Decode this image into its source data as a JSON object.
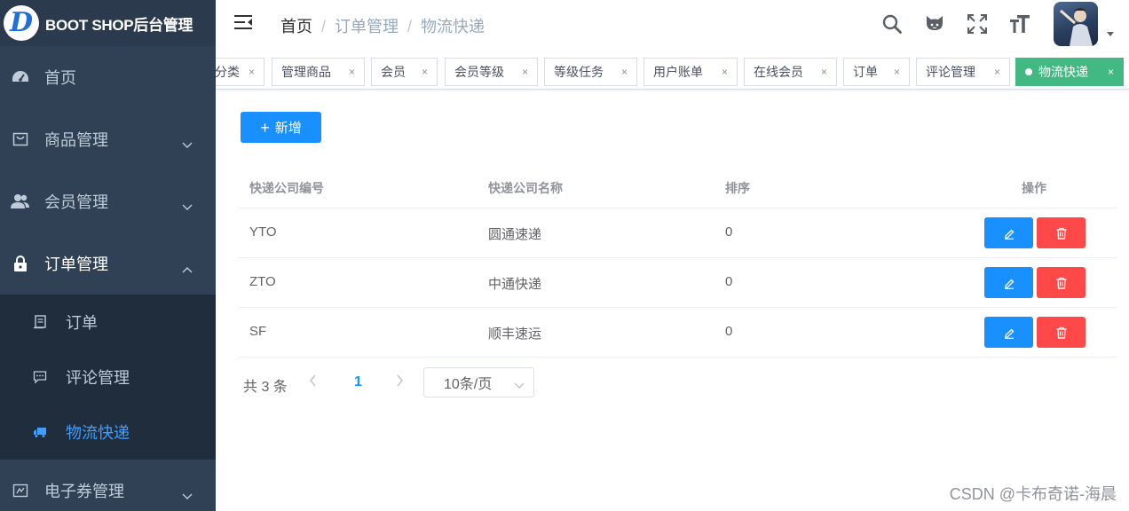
{
  "app": {
    "title": "BOOT SHOP后台管理",
    "logo_letter": "D"
  },
  "sidebar": {
    "items": [
      {
        "label": "首页",
        "icon": "dashboard-icon"
      },
      {
        "label": "商品管理",
        "icon": "shopping-bag-icon"
      },
      {
        "label": "会员管理",
        "icon": "users-icon"
      },
      {
        "label": "订单管理",
        "icon": "lock-icon"
      },
      {
        "label": "电子券管理",
        "icon": "coupon-icon"
      }
    ],
    "order_sub": [
      {
        "label": "订单",
        "icon": "document-icon"
      },
      {
        "label": "评论管理",
        "icon": "comment-icon"
      },
      {
        "label": "物流快递",
        "icon": "truck-icon"
      }
    ]
  },
  "breadcrumb": {
    "home": "首页",
    "section": "订单管理",
    "current": "物流快递",
    "separator": "/"
  },
  "tags": [
    {
      "label": "分类"
    },
    {
      "label": "管理商品"
    },
    {
      "label": "会员"
    },
    {
      "label": "会员等级"
    },
    {
      "label": "等级任务"
    },
    {
      "label": "用户账单"
    },
    {
      "label": "在线会员"
    },
    {
      "label": "订单"
    },
    {
      "label": "评论管理"
    },
    {
      "label": "物流快递",
      "active": true
    }
  ],
  "tag_close": "×",
  "toolbar": {
    "add_label": "新增",
    "add_icon": "+"
  },
  "table": {
    "headers": {
      "code": "快递公司编号",
      "name": "快递公司名称",
      "sort": "排序",
      "ops": "操作"
    },
    "rows": [
      {
        "code": "YTO",
        "name": "圆通速递",
        "sort": "0"
      },
      {
        "code": "ZTO",
        "name": "中通快递",
        "sort": "0"
      },
      {
        "code": "SF",
        "name": "顺丰速运",
        "sort": "0"
      }
    ]
  },
  "pagination": {
    "total_text": "共 3 条",
    "current_page": "1",
    "page_size": "10条/页"
  },
  "watermark": "CSDN @卡布奇诺-海晨",
  "colors": {
    "sidebar_bg": "#304156",
    "active_blue": "#409eff",
    "primary": "#1890ff",
    "danger": "#ff4949",
    "tag_active": "#42b983"
  }
}
